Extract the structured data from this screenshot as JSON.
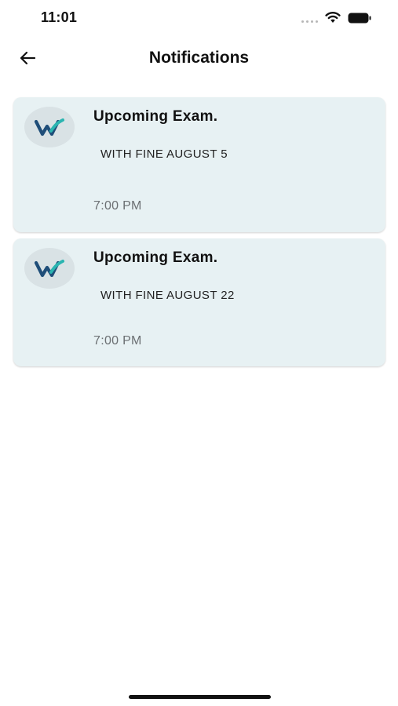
{
  "status_bar": {
    "time": "11:01",
    "wifi_icon": "wifi-icon",
    "battery_icon": "battery-icon"
  },
  "header": {
    "title": "Notifications",
    "back_icon": "arrow-left-icon"
  },
  "notifications": [
    {
      "title": "Upcoming Exam.",
      "body": "WITH FINE AUGUST 5",
      "time": "7:00 PM"
    },
    {
      "title": "Upcoming Exam.",
      "body": "WITH FINE AUGUST 22",
      "time": "7:00 PM"
    }
  ],
  "colors": {
    "card_background": "#e7f1f3",
    "logo_dark": "#1f4e79",
    "logo_accent": "#2bb5b1"
  }
}
